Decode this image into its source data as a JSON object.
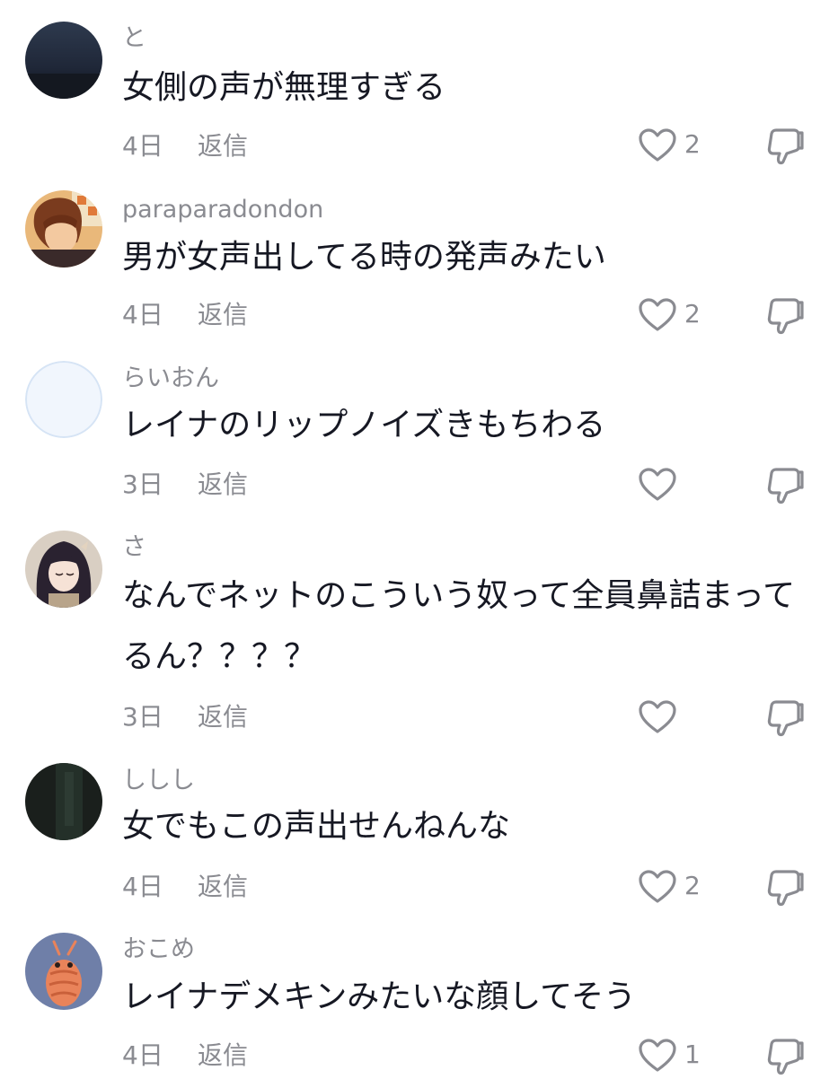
{
  "labels": {
    "reply": "返信"
  },
  "comments": [
    {
      "username": "と",
      "text": "女側の声が無理すぎる",
      "age": "4日",
      "likes": "2",
      "avatar_icon": "dark-landscape-avatar"
    },
    {
      "username": "paraparadondon",
      "text": "男が女声出してる時の発声みたい",
      "age": "4日",
      "likes": "2",
      "avatar_icon": "anime-character-avatar"
    },
    {
      "username": "らいおん",
      "text": "レイナのリップノイズきもちわる",
      "age": "3日",
      "likes": "",
      "avatar_icon": "blank-avatar"
    },
    {
      "username": "さ",
      "text": "なんでネットのこういう奴って全員鼻詰まってるん？？？？",
      "age": "3日",
      "likes": "",
      "avatar_icon": "anime-girl-avatar"
    },
    {
      "username": "ししし",
      "text": "女でもこの声出せんねんな",
      "age": "4日",
      "likes": "2",
      "avatar_icon": "dark-photo-avatar"
    },
    {
      "username": "おこめ",
      "text": "レイナデメキンみたいな顔してそう",
      "age": "4日",
      "likes": "1",
      "avatar_icon": "shrimp-character-avatar"
    }
  ],
  "colors": {
    "primary_text": "#161823",
    "secondary_text": "#8a8b91",
    "icon_stroke": "#8a8b91",
    "background": "#ffffff"
  }
}
